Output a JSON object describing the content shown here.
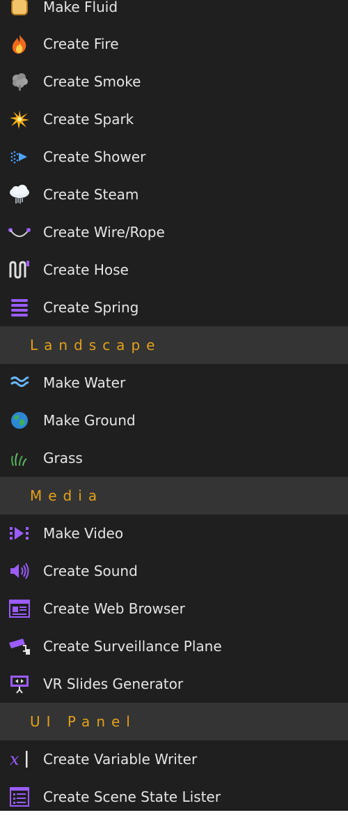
{
  "colors": {
    "background": "#1f1f1f",
    "section_background": "#343434",
    "section_text": "#e3a21a",
    "item_text": "#e6e6e6",
    "purple_icons": "#9b5cff",
    "blue_icons": "#4aa3ff"
  },
  "menu": {
    "items_top": [
      {
        "label": "Make Fluid",
        "icon": "fluid-icon"
      },
      {
        "label": "Create Fire",
        "icon": "fire-icon"
      },
      {
        "label": "Create Smoke",
        "icon": "smoke-icon"
      },
      {
        "label": "Create Spark",
        "icon": "spark-icon"
      },
      {
        "label": "Create Shower",
        "icon": "shower-icon"
      },
      {
        "label": "Create Steam",
        "icon": "steam-icon"
      },
      {
        "label": "Create Wire/Rope",
        "icon": "wire-rope-icon"
      },
      {
        "label": "Create Hose",
        "icon": "hose-icon"
      },
      {
        "label": "Create Spring",
        "icon": "spring-icon"
      }
    ],
    "sections": [
      {
        "title": "Landscape",
        "items": [
          {
            "label": "Make Water",
            "icon": "water-icon"
          },
          {
            "label": "Make Ground",
            "icon": "ground-icon"
          },
          {
            "label": "Grass",
            "icon": "grass-icon"
          }
        ]
      },
      {
        "title": "Media",
        "items": [
          {
            "label": "Make Video",
            "icon": "video-icon"
          },
          {
            "label": "Create Sound",
            "icon": "sound-icon"
          },
          {
            "label": "Create Web Browser",
            "icon": "web-browser-icon"
          },
          {
            "label": "Create Surveillance Plane",
            "icon": "surveillance-camera-icon"
          },
          {
            "label": "VR Slides Generator",
            "icon": "slides-icon"
          }
        ]
      },
      {
        "title": "UI Panel",
        "items": [
          {
            "label": "Create Variable Writer",
            "icon": "variable-writer-icon"
          },
          {
            "label": "Create Scene State Lister",
            "icon": "list-icon"
          }
        ]
      }
    ]
  }
}
